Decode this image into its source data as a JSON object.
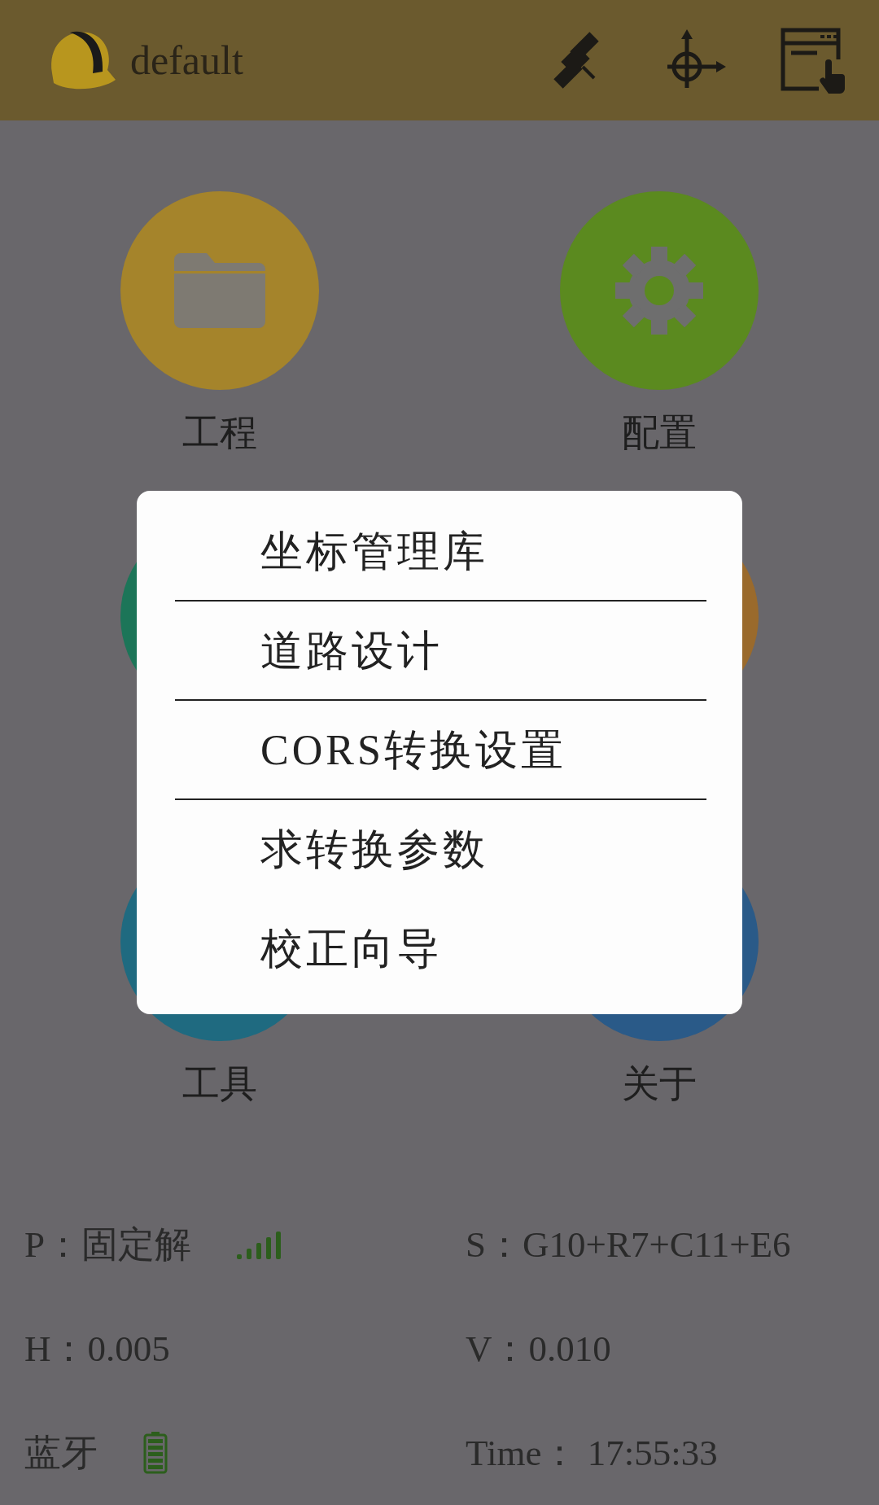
{
  "header": {
    "title": "default"
  },
  "tiles": [
    {
      "label": "工程",
      "color": "#a5842b"
    },
    {
      "label": "配置",
      "color": "#5b8a1f"
    },
    {
      "color": "#1c7558"
    },
    {
      "color": "#9a6a2c"
    },
    {
      "label": "工具",
      "color": "#1f6a80"
    },
    {
      "label": "关于",
      "color": "#2a5a88"
    }
  ],
  "menu": {
    "items": [
      {
        "label": "坐标管理库",
        "divider": true
      },
      {
        "label": "道路设计",
        "divider": true
      },
      {
        "label": "CORS转换设置",
        "divider": true
      },
      {
        "label": "求转换参数",
        "divider": false
      },
      {
        "label": "校正向导",
        "divider": false
      }
    ]
  },
  "status": [
    {
      "text": "P：固定解"
    },
    {
      "text": "S：G10+R7+C11+E6"
    },
    {
      "text": "H：0.005"
    },
    {
      "text": "V：0.010"
    },
    {
      "text": "蓝牙"
    },
    {
      "text": "Time： 17:55:33"
    }
  ]
}
